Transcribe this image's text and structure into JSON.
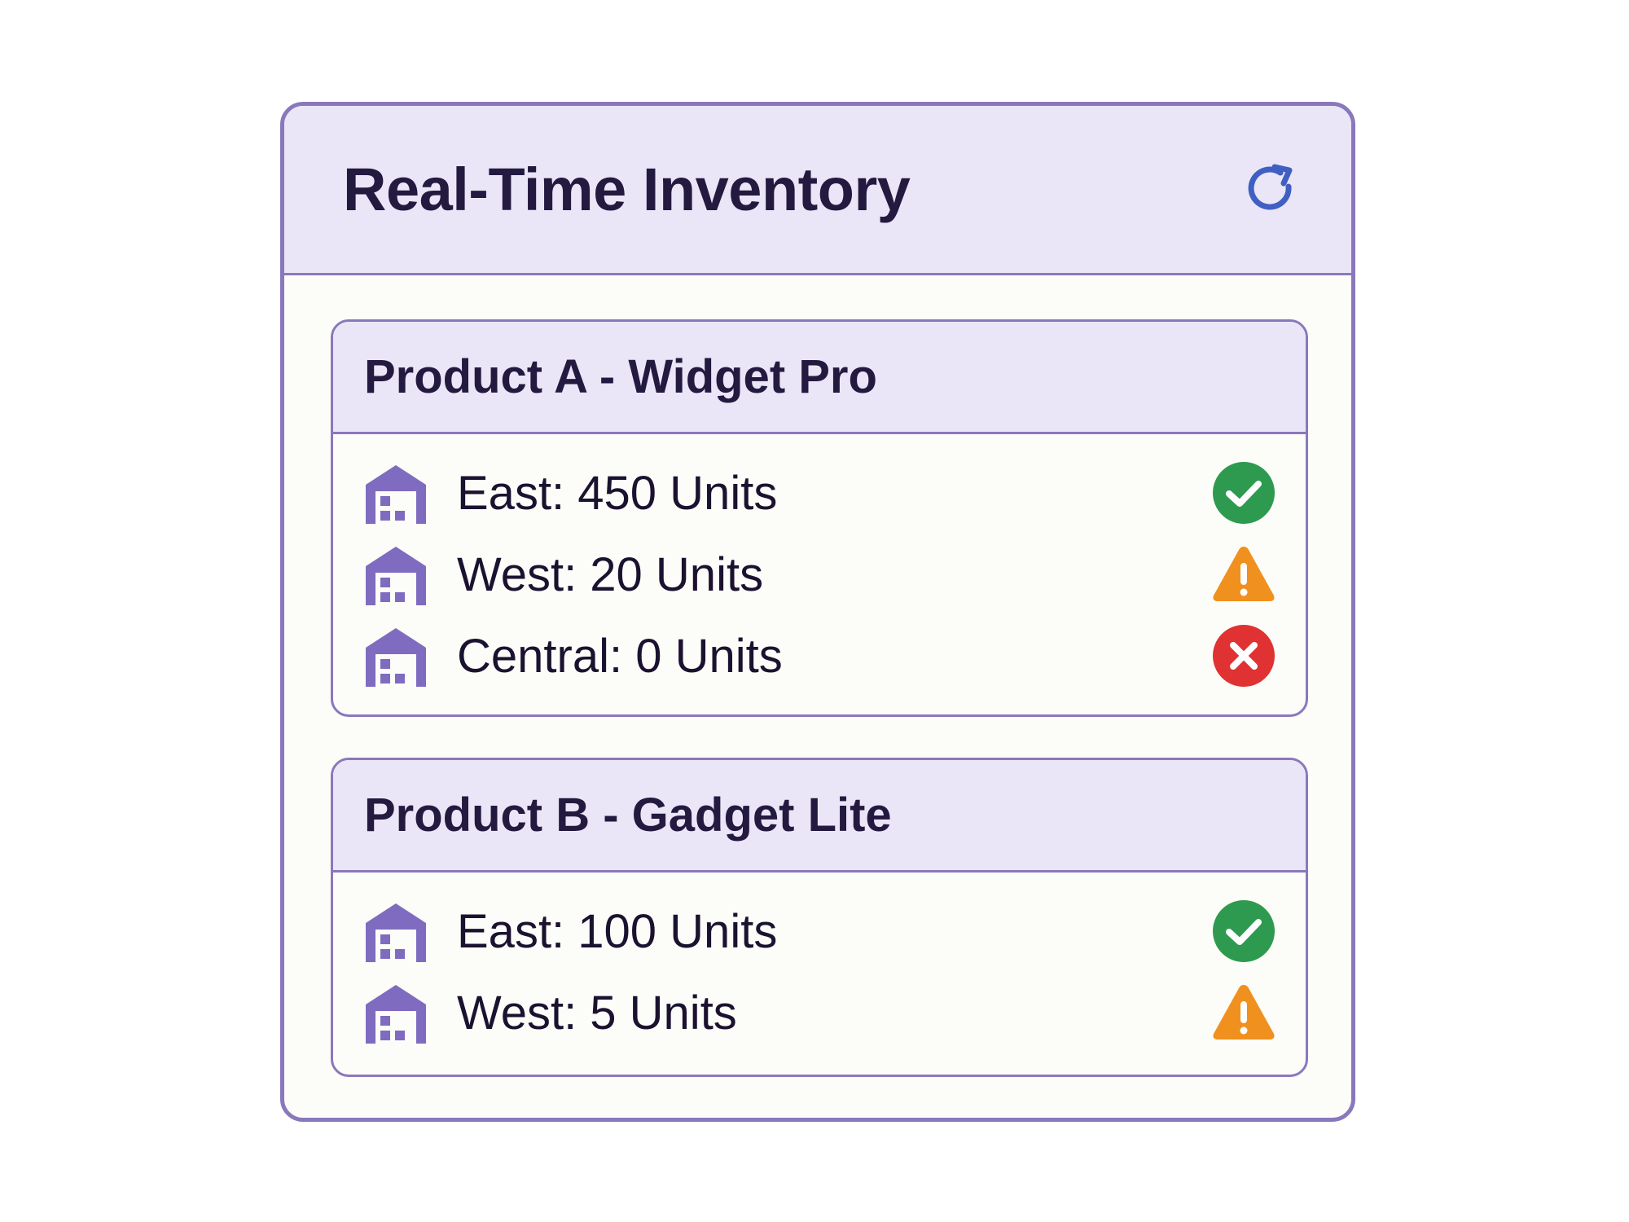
{
  "widget": {
    "title": "Real-Time Inventory",
    "refresh_icon": "refresh-icon"
  },
  "colors": {
    "border": "#8a78bd",
    "header_bg": "#ebe6f7",
    "warehouse_icon": "#7f6cc0",
    "ok": "#2e9a4f",
    "warning": "#f0901e",
    "error": "#e03232",
    "refresh": "#3f5fc2"
  },
  "products": [
    {
      "title": "Product A - Widget Pro",
      "rows": [
        {
          "label": "East: 450 Units",
          "icon": "warehouse-icon",
          "status": "ok"
        },
        {
          "label": "West: 20 Units",
          "icon": "warehouse-icon",
          "status": "warning"
        },
        {
          "label": "Central: 0 Units",
          "icon": "warehouse-icon",
          "status": "error"
        }
      ]
    },
    {
      "title": "Product B - Gadget Lite",
      "rows": [
        {
          "label": "East: 100 Units",
          "icon": "warehouse-icon",
          "status": "ok"
        },
        {
          "label": "West: 5 Units",
          "icon": "warehouse-icon",
          "status": "warning"
        }
      ]
    }
  ]
}
